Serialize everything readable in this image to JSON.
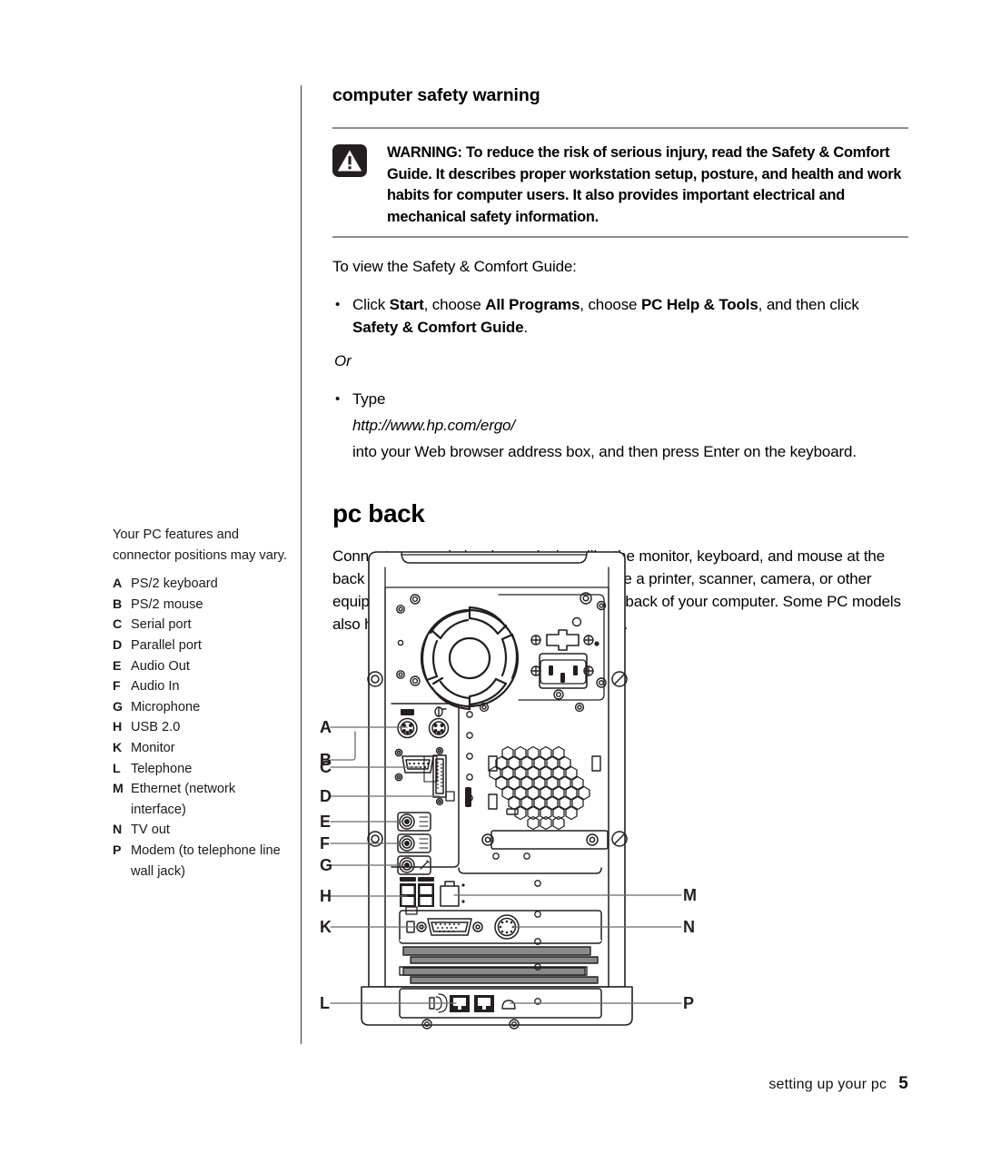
{
  "page": {
    "footer_label": "setting up your pc",
    "page_number": "5"
  },
  "safety": {
    "heading": "computer safety warning",
    "warning_icon": "warning-triangle-icon",
    "warning_text": "WARNING: To reduce the risk of serious injury, read the Safety & Comfort Guide. It describes proper workstation setup, posture, and health and work habits for computer users. It also provides important electrical and mechanical safety information.",
    "intro": "To view the Safety & Comfort Guide:",
    "bullet1": {
      "dot": "•",
      "part1": "Click ",
      "bold1": "Start",
      "part2": ", choose ",
      "bold2": "All Programs",
      "part3": ", choose ",
      "bold3": "PC Help & Tools",
      "part4": ", and then click ",
      "bold4": "Safety & Comfort Guide",
      "part5": "."
    },
    "or": "Or",
    "bullet2": {
      "dot": "•",
      "lead": "Type",
      "url": "http://www.hp.com/ergo/",
      "tail": "into your Web browser address box, and then press Enter on the keyboard."
    }
  },
  "pcback": {
    "heading": "pc back",
    "paragraph": "Connect your main hardware devices like the monitor, keyboard, and mouse at the back of the PC. Other peripheral devices like a printer, scanner, camera, or other equipment also plug into connectors on the back of your computer. Some PC models also have connectors on the front of the PC."
  },
  "sidenote": {
    "intro": "Your PC features and connector positions may vary.",
    "items": [
      {
        "key": "A",
        "label": "PS/2 keyboard"
      },
      {
        "key": "B",
        "label": "PS/2 mouse"
      },
      {
        "key": "C",
        "label": "Serial port"
      },
      {
        "key": "D",
        "label": "Parallel port"
      },
      {
        "key": "E",
        "label": "Audio Out"
      },
      {
        "key": "F",
        "label": "Audio In"
      },
      {
        "key": "G",
        "label": "Microphone"
      },
      {
        "key": "H",
        "label": "USB 2.0"
      },
      {
        "key": "K",
        "label": "Monitor"
      },
      {
        "key": "L",
        "label": "Telephone"
      },
      {
        "key": "M",
        "label": "Ethernet (network interface)"
      },
      {
        "key": "N",
        "label": "TV out"
      },
      {
        "key": "P",
        "label": "Modem (to telephone line wall jack)"
      }
    ]
  },
  "diagram": {
    "title": "pc-back-panel-diagram",
    "callouts_left": [
      "A",
      "B",
      "C",
      "D",
      "E",
      "F",
      "G",
      "H",
      "K",
      "L"
    ],
    "callouts_right": [
      "M",
      "N",
      "P"
    ]
  },
  "colors": {
    "rule": "#8d8d8d",
    "text": "#000000",
    "leader": "#555555"
  }
}
